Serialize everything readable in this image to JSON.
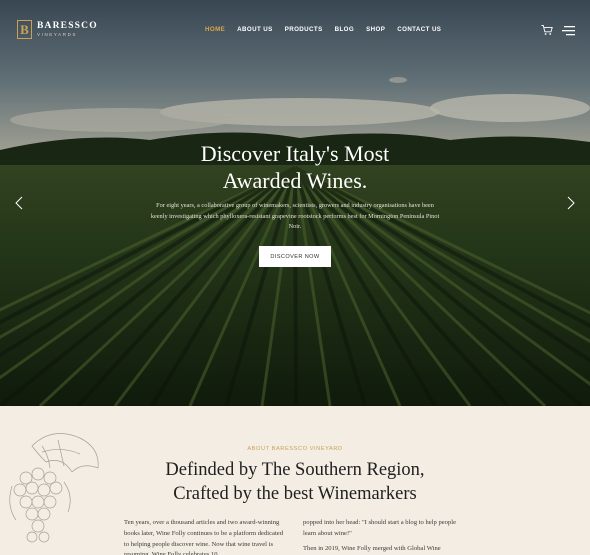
{
  "brand": {
    "name": "BARESSCO",
    "tagline": "VINEYARDS",
    "mark": "B",
    "accent": "#c9a25a"
  },
  "nav": {
    "items": [
      {
        "label": "HOME",
        "active": true
      },
      {
        "label": "ABOUT US",
        "active": false
      },
      {
        "label": "PRODUCTS",
        "active": false
      },
      {
        "label": "BLOG",
        "active": false
      },
      {
        "label": "SHOP",
        "active": false
      },
      {
        "label": "CONTACT US",
        "active": false
      }
    ],
    "icons": [
      "cart-icon",
      "hamburger-menu-icon"
    ]
  },
  "hero": {
    "title_line1": "Discover Italy's Most",
    "title_line2": "Awarded Wines.",
    "description": "For eight years, a collaborative group of winemakers, scientists, growers and industry organisations have been keenly investigating which phylloxera-resistant grapevine rootstock performs best for Mornington Peninsula Pinot Noir.",
    "cta_label": "DISCOVER NOW",
    "icons": [
      "chevron-left-icon",
      "chevron-right-icon"
    ]
  },
  "about": {
    "eyebrow": "ABOUT BARESSCO VINEYARD",
    "title_line1": "Definded by The Southern Region,",
    "title_line2": "Crafted by the best Winemarkers",
    "col1": "Ten years, over a thousand articles and two award-winning books later, Wine Folly continues to be a platform dedicated to helping people discover wine. Now that wine travel is resuming, Wine Folly celebrates 10",
    "col2_p1": "popped into her head: \"I should start a blog to help people learn about wine!\"",
    "col2_p2": "Then in 2019, Wine Folly merged with Global Wine"
  }
}
